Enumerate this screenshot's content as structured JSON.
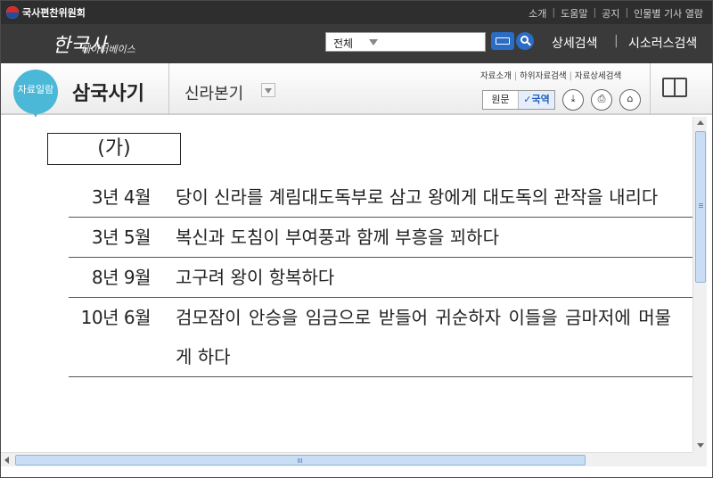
{
  "colors": {
    "header_bg": "#3a3a3a",
    "titlebar_bg": "#2e2e2e",
    "accent_blue": "#2b6cc4",
    "badge_teal": "#4cb8d8"
  },
  "titlebar": {
    "org_name": "국사편찬위원회",
    "links": [
      "소개",
      "도움말",
      "공지",
      "인물별 기사 열람"
    ]
  },
  "header": {
    "brand_big": "한국사",
    "brand_small": "데이터베이스",
    "search_scope": "전체",
    "advanced_search": "상세검색",
    "separator": "|",
    "thesaurus_search": "시소러스검색"
  },
  "toolbar": {
    "list_badge": "자료일람",
    "book_title": "삼국사기",
    "chapter": "신라본기",
    "sub_links": [
      "자료소개",
      "하위자료검색",
      "자료상세검색"
    ],
    "lang_original": "원문",
    "lang_translation": "✓국역",
    "icons": [
      "download-icon",
      "print-icon",
      "archive-icon",
      "book-icon"
    ]
  },
  "content": {
    "label": "(가)",
    "events": [
      {
        "date": "3년 4월",
        "text": "당이 신라를 계림대도독부로 삼고 왕에게 대도독의 관작을 내리다"
      },
      {
        "date": "3년 5월",
        "text": "복신과 도침이 부여풍과 함께 부흥을 꾀하다"
      },
      {
        "date": "8년 9월",
        "text": "고구려 왕이 항복하다"
      },
      {
        "date": "10년 6월",
        "text": "검모잠이 안승을 임금으로 받들어 귀순하자 이들을 금마저에 머물게 하다"
      }
    ]
  }
}
